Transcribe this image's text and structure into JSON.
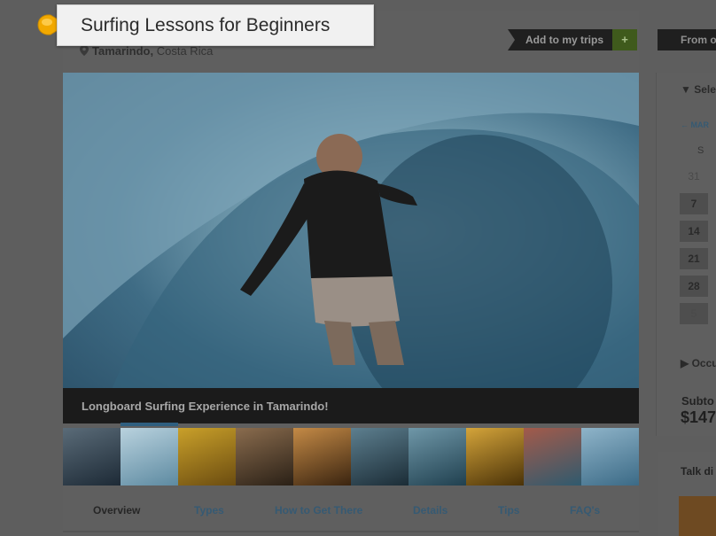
{
  "listing": {
    "title": "Surfing Lessons for Beginners",
    "location_city": "Tamarindo,",
    "location_country": "Costa Rica",
    "add_trips_label": "Add to my trips",
    "add_trips_plus": "+",
    "hero_caption": "Longboard Surfing Experience in Tamarindo!",
    "thumbnail_count": 10,
    "active_thumbnail": 2
  },
  "tabs": [
    "Overview",
    "Types",
    "How to Get There",
    "Details",
    "Tips",
    "FAQ's"
  ],
  "sidebar": {
    "price_from": "From o",
    "select_label": "Selec",
    "month_label": "MAR",
    "weekday": "S",
    "days": [
      "31",
      "7",
      "14",
      "21",
      "28",
      "5"
    ],
    "occupancy_label": "Occu",
    "subtotal_label": "Subto",
    "subtotal_value": "$147",
    "talk_label": "Talk di"
  },
  "colors": {
    "overlay": "#5e5e5e",
    "callout_bg": "#f1f1f1",
    "pointer": "#f2a900",
    "link": "#365a73",
    "plus_green": "#3f5a1c"
  }
}
